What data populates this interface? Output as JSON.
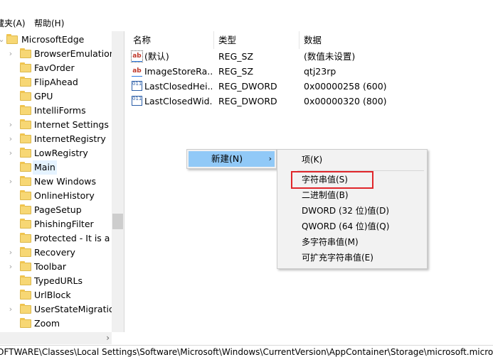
{
  "menubar": {
    "favorites": "藏夹(A)",
    "help": "帮助(H)"
  },
  "tree": {
    "root": "MicrosoftEdge",
    "items": [
      {
        "label": "BrowserEmulation",
        "expandable": true
      },
      {
        "label": "FavOrder",
        "expandable": false
      },
      {
        "label": "FlipAhead",
        "expandable": false
      },
      {
        "label": "GPU",
        "expandable": false
      },
      {
        "label": "IntelliForms",
        "expandable": false
      },
      {
        "label": "Internet Settings",
        "expandable": true
      },
      {
        "label": "InternetRegistry",
        "expandable": true
      },
      {
        "label": "LowRegistry",
        "expandable": true
      },
      {
        "label": "Main",
        "expandable": false,
        "selected": true
      },
      {
        "label": "New Windows",
        "expandable": true
      },
      {
        "label": "OnlineHistory",
        "expandable": false
      },
      {
        "label": "PageSetup",
        "expandable": false
      },
      {
        "label": "PhishingFilter",
        "expandable": false
      },
      {
        "label": "Protected - It is a v",
        "expandable": false
      },
      {
        "label": "Recovery",
        "expandable": true
      },
      {
        "label": "Toolbar",
        "expandable": true
      },
      {
        "label": "TypedURLs",
        "expandable": false
      },
      {
        "label": "UrlBlock",
        "expandable": false
      },
      {
        "label": "UserStateMigration",
        "expandable": true
      },
      {
        "label": "Zoom",
        "expandable": false
      }
    ]
  },
  "values": {
    "headers": {
      "name": "名称",
      "type": "类型",
      "data": "数据"
    },
    "rows": [
      {
        "icon": "ab",
        "name": "(默认)",
        "type": "REG_SZ",
        "data": "(数值未设置)"
      },
      {
        "icon": "ab",
        "name": "ImageStoreRa...",
        "type": "REG_SZ",
        "data": "qtj23rp"
      },
      {
        "icon": "bin",
        "name": "LastClosedHei...",
        "type": "REG_DWORD",
        "data": "0x00000258 (600)"
      },
      {
        "icon": "bin",
        "name": "LastClosedWid...",
        "type": "REG_DWORD",
        "data": "0x00000320 (800)"
      }
    ]
  },
  "context_menu": {
    "new": "新建(N)",
    "submenu": {
      "key": "项(K)",
      "string": "字符串值(S)",
      "binary": "二进制值(B)",
      "dword": "DWORD (32 位)值(D)",
      "qword": "QWORD (64 位)值(Q)",
      "multi": "多字符串值(M)",
      "expand": "可扩充字符串值(E)"
    }
  },
  "statusbar": {
    "path": "OFTWARE\\Classes\\Local Settings\\Software\\Microsoft\\Windows\\CurrentVersion\\AppContainer\\Storage\\microsoft.micros"
  },
  "colors": {
    "highlight_box": "#e0262a",
    "menu_hover": "#91c9f7",
    "folder": "#f7d774"
  }
}
